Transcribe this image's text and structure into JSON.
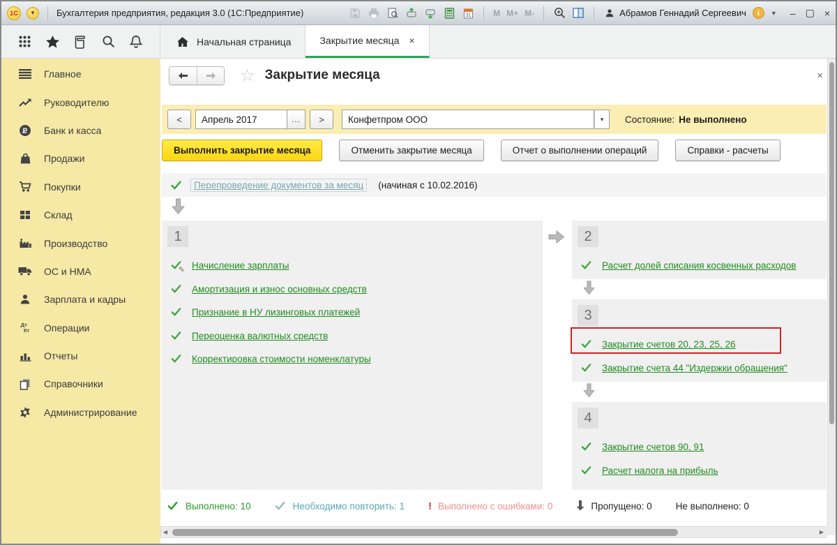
{
  "glyphs": {
    "close": "×",
    "minimize": "–",
    "maximize": "▢",
    "prev": "<",
    "next": ">",
    "more": "...",
    "dropdown": "▾",
    "excl": "!"
  },
  "title_bar": {
    "app_title": "Бухгалтерия предприятия, редакция 3.0  (1С:Предприятие)",
    "memory": [
      "M",
      "M+",
      "M-"
    ],
    "user_name": "Абрамов Геннадий Сергеевич"
  },
  "tabs": {
    "home": "Начальная страница",
    "active": "Закрытие месяца"
  },
  "sidebar": {
    "items": [
      {
        "label": "Главное"
      },
      {
        "label": "Руководителю"
      },
      {
        "label": "Банк и касса"
      },
      {
        "label": "Продажи"
      },
      {
        "label": "Покупки"
      },
      {
        "label": "Склад"
      },
      {
        "label": "Производство"
      },
      {
        "label": "ОС и НМА"
      },
      {
        "label": "Зарплата и кадры"
      },
      {
        "label": "Операции"
      },
      {
        "label": "Отчеты"
      },
      {
        "label": "Справочники"
      },
      {
        "label": "Администрирование"
      }
    ]
  },
  "page": {
    "title": "Закрытие месяца",
    "filter": {
      "period": "Апрель 2017",
      "company": "Конфетпром ООО",
      "status_label": "Состояние:",
      "status_value": "Не выполнено"
    },
    "actions": {
      "execute": "Выполнить закрытие месяца",
      "cancel": "Отменить закрытие месяца",
      "report": "Отчет о выполнении операций",
      "references": "Справки - расчеты"
    },
    "reposting": {
      "link": "Перепроведение документов за месяц",
      "note": "(начиная с 10.02.2016)"
    },
    "blocks": [
      {
        "num": "1",
        "items": [
          {
            "label": "Начисление зарплаты",
            "icon": "check-pencil"
          },
          {
            "label": "Амортизация и износ основных средств",
            "icon": "check"
          },
          {
            "label": "Признание в НУ лизинговых платежей",
            "icon": "check"
          },
          {
            "label": "Переоценка валютных средств",
            "icon": "check"
          },
          {
            "label": "Корректировка стоимости номенклатуры",
            "icon": "check"
          }
        ]
      },
      {
        "num": "2",
        "items": [
          {
            "label": "Расчет долей списания косвенных расходов",
            "icon": "check"
          }
        ]
      },
      {
        "num": "3",
        "items": [
          {
            "label": "Закрытие счетов 20, 23, 25, 26",
            "icon": "check",
            "highlighted": true
          },
          {
            "label": "Закрытие счета 44 \"Издержки обращения\"",
            "icon": "check"
          }
        ]
      },
      {
        "num": "4",
        "items": [
          {
            "label": "Закрытие счетов 90, 91",
            "icon": "check"
          },
          {
            "label": "Расчет налога на прибыль",
            "icon": "check"
          }
        ]
      }
    ],
    "legend": {
      "done_label": "Выполнено:",
      "done_value": "10",
      "repeat_label": "Необходимо повторить:",
      "repeat_value": "1",
      "errors_label": "Выполнено с ошибками:",
      "errors_value": "0",
      "skipped_label": "Пропущено:",
      "skipped_value": "0",
      "notdone_label": "Не выполнено:",
      "notdone_value": "0"
    },
    "colors": {
      "link_green": "#1f8b1f",
      "execute_button_yellow": "#fbd60f",
      "sidebar_yellow": "#f6e9a6",
      "filter_bar_yellow": "#fbeeb4",
      "tab_underline_green": "#2fa35c",
      "repeat_teal": "#58a7b3",
      "errors_pink": "#f08f8f",
      "highlight_red": "#cc2424"
    }
  }
}
